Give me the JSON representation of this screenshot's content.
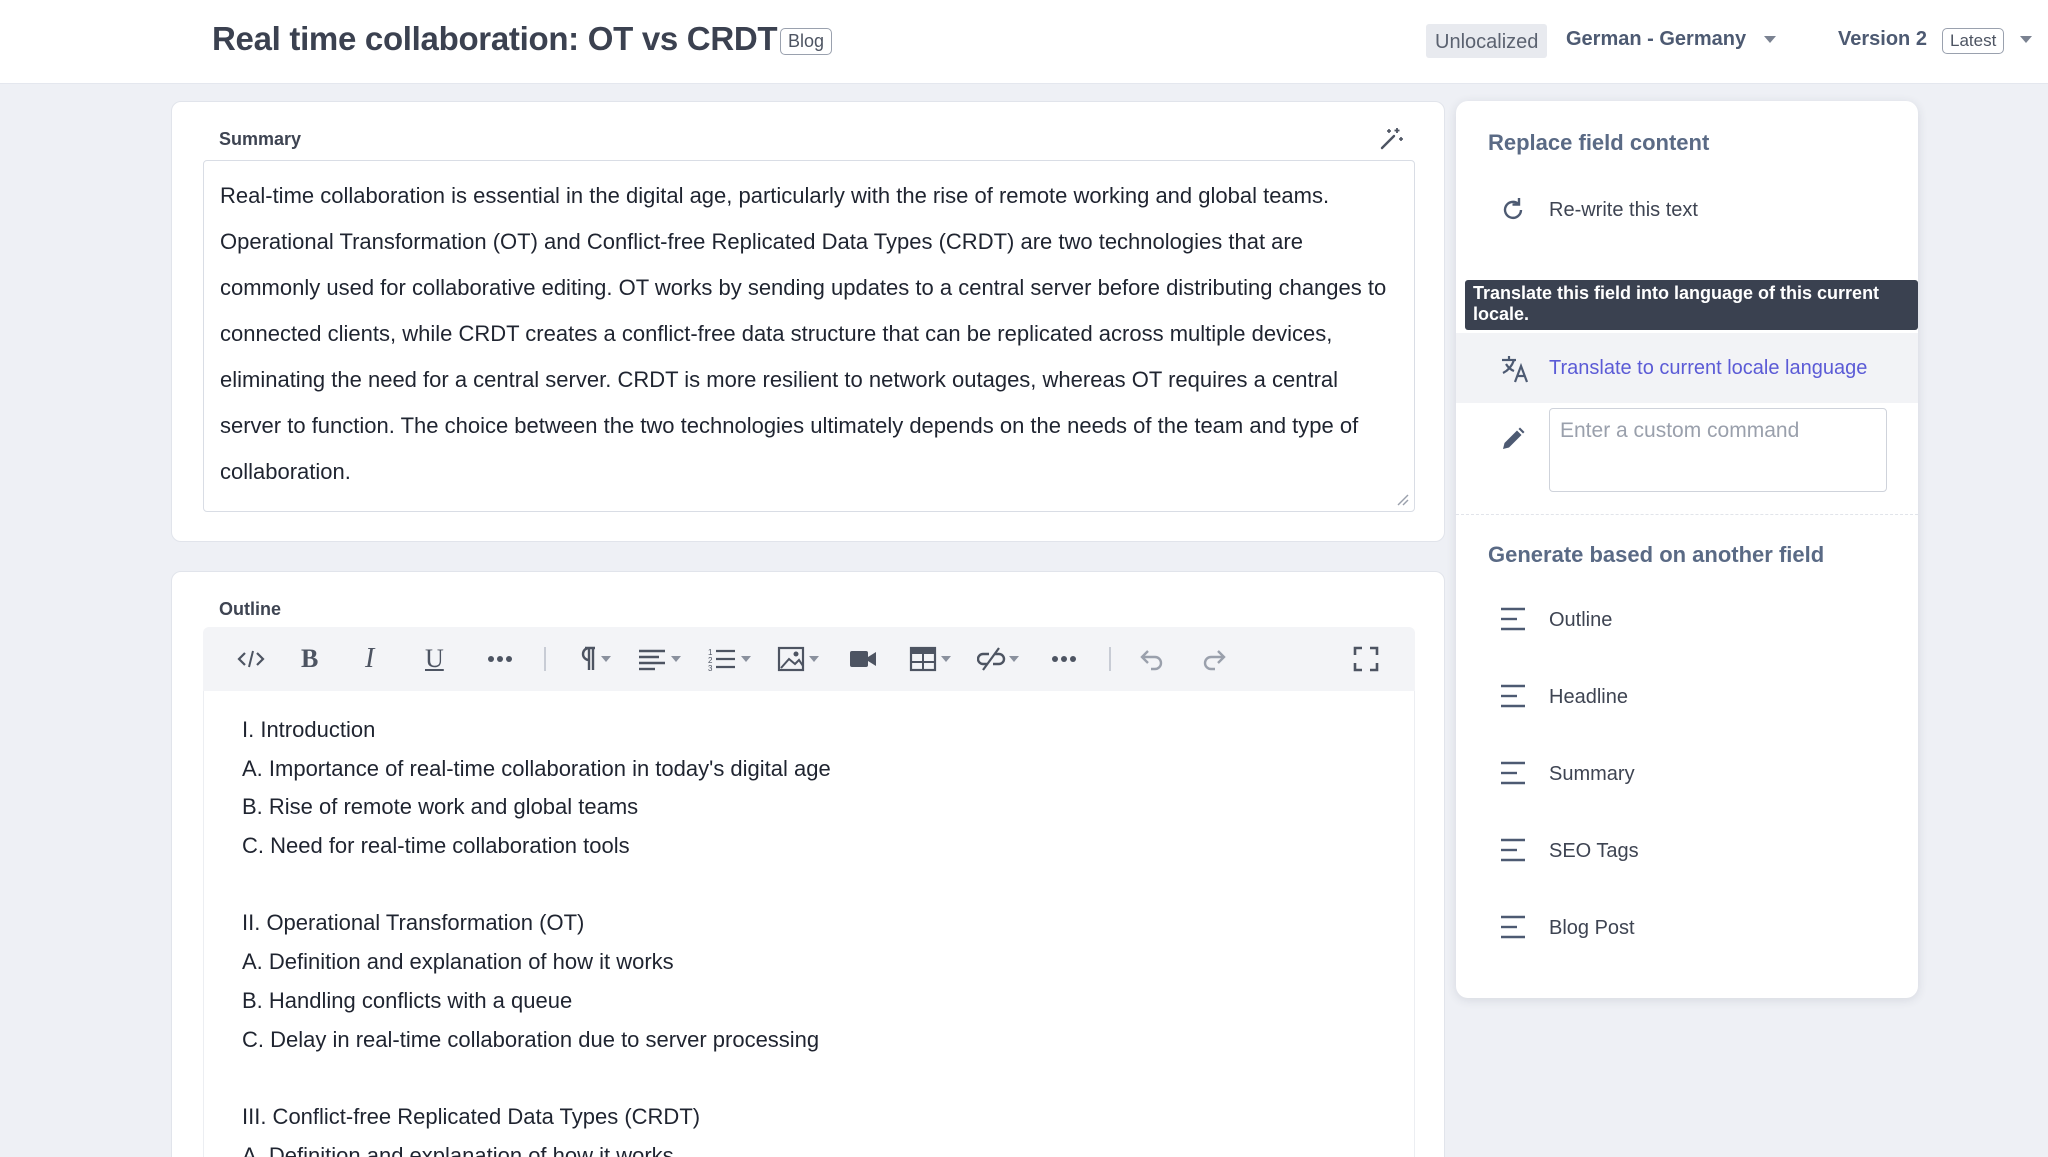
{
  "header": {
    "title": "Real time collaboration: OT vs CRDT",
    "content_type_badge": "Blog",
    "unlocalized_label": "Unlocalized",
    "locale": "German - Germany",
    "version_label": "Version 2",
    "version_badge": "Latest"
  },
  "summary": {
    "label": "Summary",
    "text": "Real-time collaboration is essential in the digital age, particularly with the rise of remote working and global teams. Operational Transformation (OT) and Conflict-free Replicated Data Types (CRDT) are two technologies that are commonly used for collaborative editing. OT works by sending updates to a central server before distributing changes to connected clients, while CRDT creates a conflict-free data structure that can be replicated across multiple devices, eliminating the need for a central server. CRDT is more resilient to network outages, whereas OT requires a central server to function. The choice between the two technologies ultimately depends on the needs of the team and type of collaboration."
  },
  "outline": {
    "label": "Outline",
    "lines": [
      "I. Introduction",
      "A. Importance of real-time collaboration in today's digital age",
      "B. Rise of remote work and global teams",
      "C. Need for real-time collaboration tools",
      "",
      "II. Operational Transformation (OT)",
      "A. Definition and explanation of how it works",
      "B. Handling conflicts with a queue",
      "C. Delay in real-time collaboration due to server processing",
      "",
      "III. Conflict-free Replicated Data Types (CRDT)",
      "A. Definition and explanation of how it works"
    ]
  },
  "ai_panel": {
    "replace_heading": "Replace field content",
    "rewrite_label": "Re-write this text",
    "tooltip": "Translate this field into language of this current locale.",
    "translate_label": "Translate to current locale language",
    "custom_placeholder": "Enter a custom command",
    "generate_heading": "Generate based on another field",
    "generate_items": [
      "Outline",
      "Headline",
      "Summary",
      "SEO Tags",
      "Blog Post"
    ]
  },
  "colors": {
    "accent": "#5b5bd6",
    "heading": "#5a6a85",
    "tooltip_bg": "#3a4150"
  }
}
